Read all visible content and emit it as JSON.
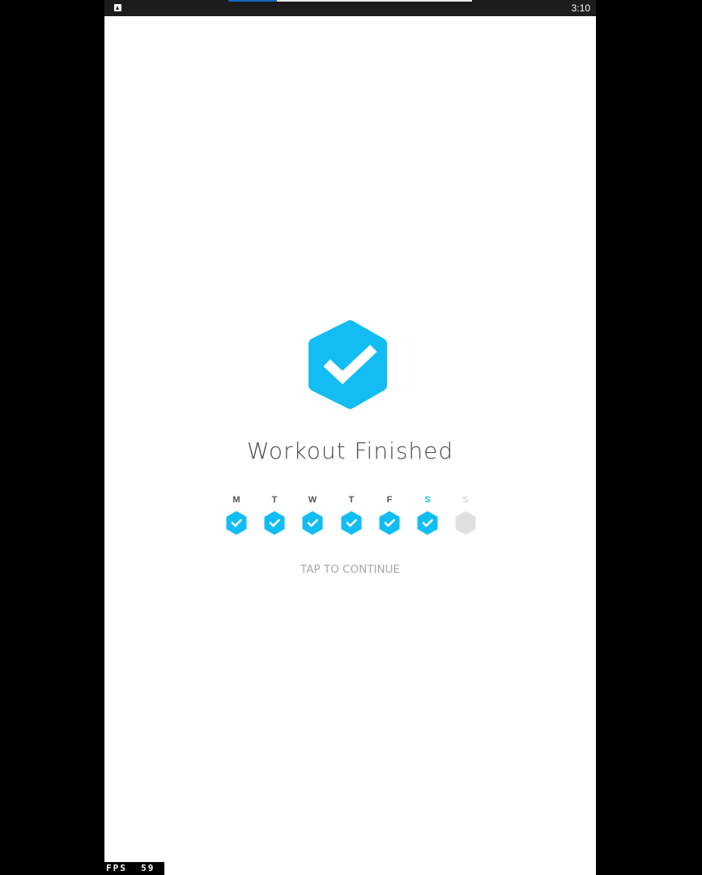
{
  "status_bar": {
    "time": "3:10",
    "app_icon": "app-notification-icon",
    "download_progress": 0.2
  },
  "hero": {
    "icon": "hexagon-check-icon",
    "color": "#12bdf4",
    "check_color": "#ffffff"
  },
  "title": "Workout Finished",
  "week": {
    "days": [
      {
        "letter": "M",
        "state": "done"
      },
      {
        "letter": "T",
        "state": "done"
      },
      {
        "letter": "W",
        "state": "done"
      },
      {
        "letter": "T",
        "state": "done"
      },
      {
        "letter": "F",
        "state": "done"
      },
      {
        "letter": "S",
        "state": "done-today"
      },
      {
        "letter": "S",
        "state": "future"
      }
    ],
    "done_color": "#12bdf4",
    "future_color": "#e0e0e0"
  },
  "continue_label": "TAP TO CONTINUE",
  "fps_overlay": {
    "label": "FPS",
    "value": "59"
  }
}
